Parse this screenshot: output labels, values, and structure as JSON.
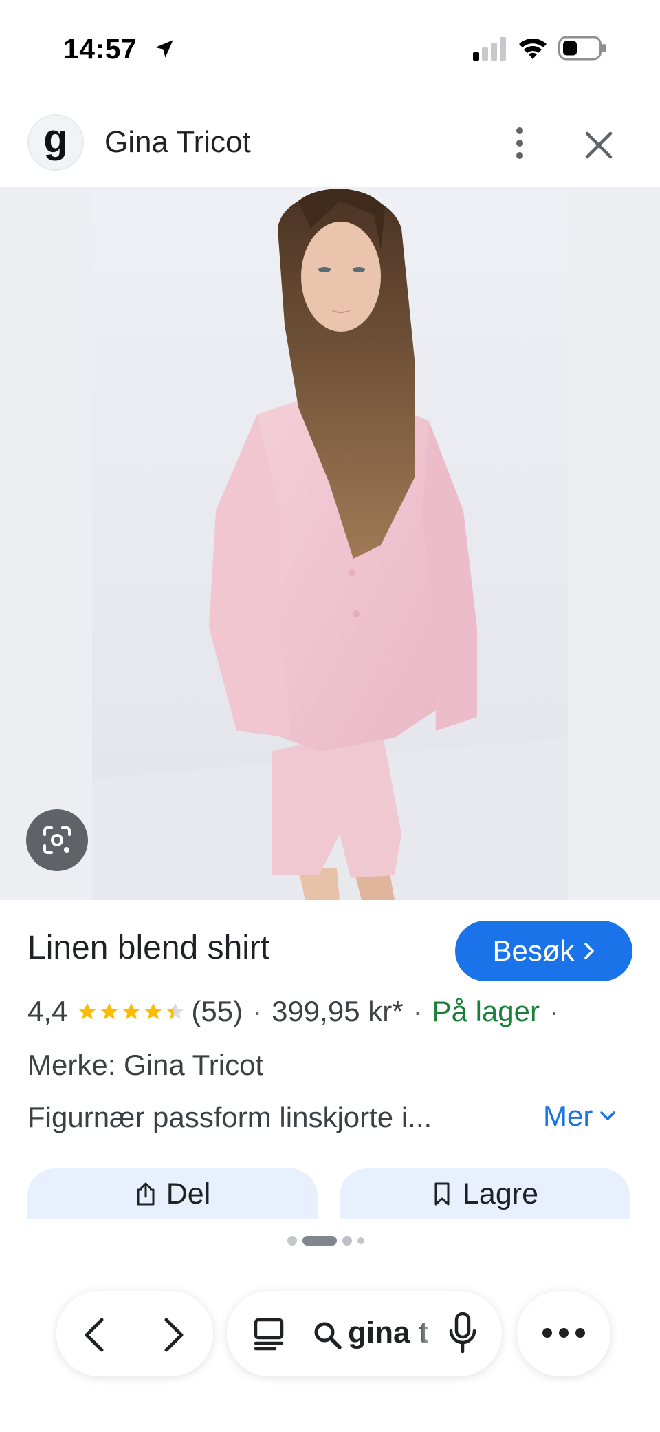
{
  "status_bar": {
    "time": "14:57",
    "icons": [
      "location-arrow-icon",
      "cellular-signal-icon",
      "wifi-icon",
      "battery-icon"
    ]
  },
  "header": {
    "logo_letter": "g",
    "site_name": "Gina Tricot",
    "icons": [
      "more-vert-icon",
      "close-icon"
    ]
  },
  "image_area": {
    "lens_icon": "google-lens-icon"
  },
  "product": {
    "title": "Linen blend shirt",
    "visit_label": "Besøk",
    "rating": "4,4",
    "stars_value": 4.4,
    "stars_max": 5,
    "reviews": "(55)",
    "price": "399,95 kr*",
    "availability": "På lager",
    "brand_line": "Merke: Gina Tricot",
    "description": "Figurnær passform linskjorte i...",
    "more_label": "Mer"
  },
  "actions": {
    "share_label": "Del",
    "save_label": "Lagre"
  },
  "pagination": {
    "dots": 4,
    "active_index": 1
  },
  "toolbar": {
    "search_text": "gina t",
    "icons": [
      "back-arrow-icon",
      "forward-arrow-icon",
      "tabs-icon",
      "search-icon",
      "microphone-icon",
      "more-horiz-icon"
    ]
  },
  "colors": {
    "accent_blue": "#1a73e8",
    "stock_green": "#188038",
    "star_yellow": "#fbbc04",
    "button_tint": "#e8f0fe"
  }
}
